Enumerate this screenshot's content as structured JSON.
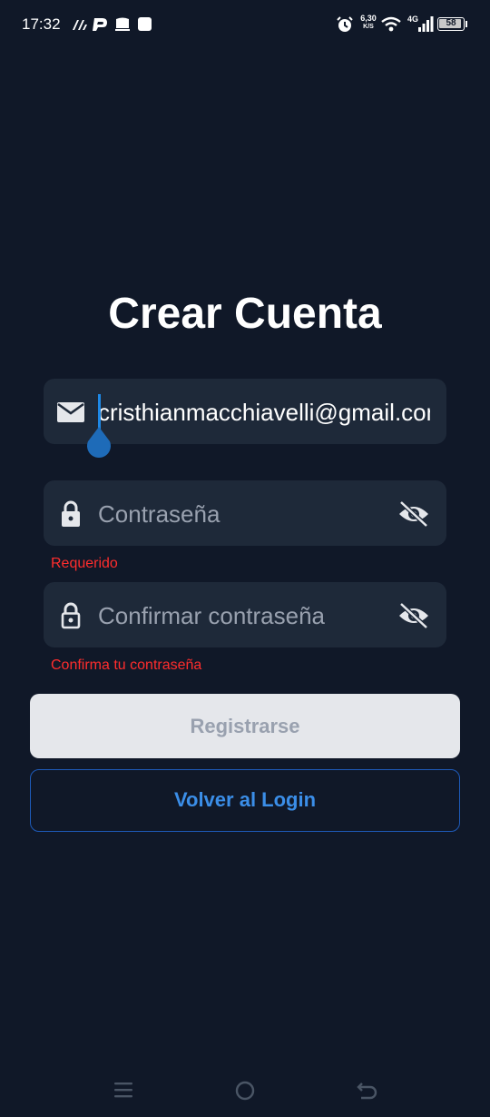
{
  "status_bar": {
    "time": "17:32",
    "net_speed": "6,30",
    "net_speed_unit": "K/S",
    "network": "4G",
    "battery": "58"
  },
  "page": {
    "title": "Crear Cuenta"
  },
  "form": {
    "email": {
      "value": "cristhianmacchiavelli@gmail.com",
      "icon": "mail-icon"
    },
    "password": {
      "placeholder": "Contraseña",
      "icon": "lock-icon",
      "toggle_icon": "eye-off-icon",
      "error": "Requerido"
    },
    "confirm_password": {
      "placeholder": "Confirmar contraseña",
      "icon": "lock-outline-icon",
      "toggle_icon": "eye-off-icon",
      "error": "Confirma tu contraseña"
    }
  },
  "actions": {
    "register_label": "Registrarse",
    "back_label": "Volver al Login"
  },
  "colors": {
    "background": "#101828",
    "field_bg": "#1e2939",
    "error": "#ff2d2d",
    "accent": "#3b8ee8",
    "cursor": "#1e88e5"
  }
}
